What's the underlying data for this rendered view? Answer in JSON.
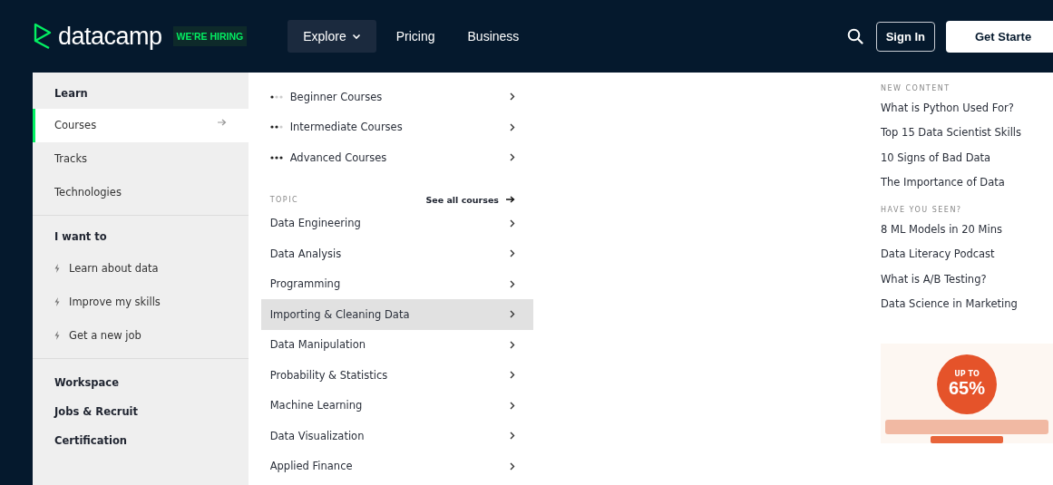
{
  "header": {
    "logo": "datacamp",
    "hiring_badge": "WE'RE HIRING",
    "nav": [
      {
        "label": "Explore",
        "selected": true,
        "dropdown": true
      },
      {
        "label": "Pricing",
        "selected": false,
        "dropdown": false
      },
      {
        "label": "Business",
        "selected": false,
        "dropdown": false
      }
    ],
    "sign_in": "Sign In",
    "get_started": "Get Starte"
  },
  "sidebar": [
    {
      "kind": "heading",
      "label": "Learn"
    },
    {
      "kind": "item",
      "label": "Courses",
      "selected": true
    },
    {
      "kind": "item",
      "label": "Tracks",
      "selected": false
    },
    {
      "kind": "item",
      "label": "Technologies",
      "selected": false
    },
    {
      "kind": "divider"
    },
    {
      "kind": "heading",
      "label": "I want to"
    },
    {
      "kind": "goal",
      "label": "Learn about data"
    },
    {
      "kind": "goal",
      "label": "Improve my skills"
    },
    {
      "kind": "goal",
      "label": "Get a new job"
    },
    {
      "kind": "divider"
    },
    {
      "kind": "link",
      "label": "Workspace"
    },
    {
      "kind": "link",
      "label": "Jobs & Recruit"
    },
    {
      "kind": "link",
      "label": "Certification"
    }
  ],
  "levels": [
    {
      "label": "Beginner Courses",
      "kind": "beginner"
    },
    {
      "label": "Intermediate Courses",
      "kind": "intermediate"
    },
    {
      "label": "Advanced Courses",
      "kind": "advanced"
    }
  ],
  "topic": {
    "title": "TOPIC",
    "see_all": "See all courses",
    "items": [
      {
        "label": "Data Engineering",
        "selected": false
      },
      {
        "label": "Data Analysis",
        "selected": false
      },
      {
        "label": "Programming",
        "selected": false
      },
      {
        "label": "Importing & Cleaning Data",
        "selected": true
      },
      {
        "label": "Data Manipulation",
        "selected": false
      },
      {
        "label": "Probability & Statistics",
        "selected": false
      },
      {
        "label": "Machine Learning",
        "selected": false
      },
      {
        "label": "Data Visualization",
        "selected": false
      },
      {
        "label": "Applied Finance",
        "selected": false
      }
    ]
  },
  "new_content": {
    "title": "NEW CONTENT",
    "items": [
      "What is Python Used For?",
      "Top 15 Data Scientist Skills",
      "10 Signs of Bad Data",
      "The Importance of Data"
    ]
  },
  "have_you_seen": {
    "title": "HAVE YOU SEEN?",
    "items": [
      "8 ML Models in 20 Mins",
      "Data Literacy Podcast",
      "What is A/B Testing?",
      "Data Science in Marketing"
    ]
  },
  "promo": {
    "up_to": "UP TO",
    "discount": "65%"
  }
}
